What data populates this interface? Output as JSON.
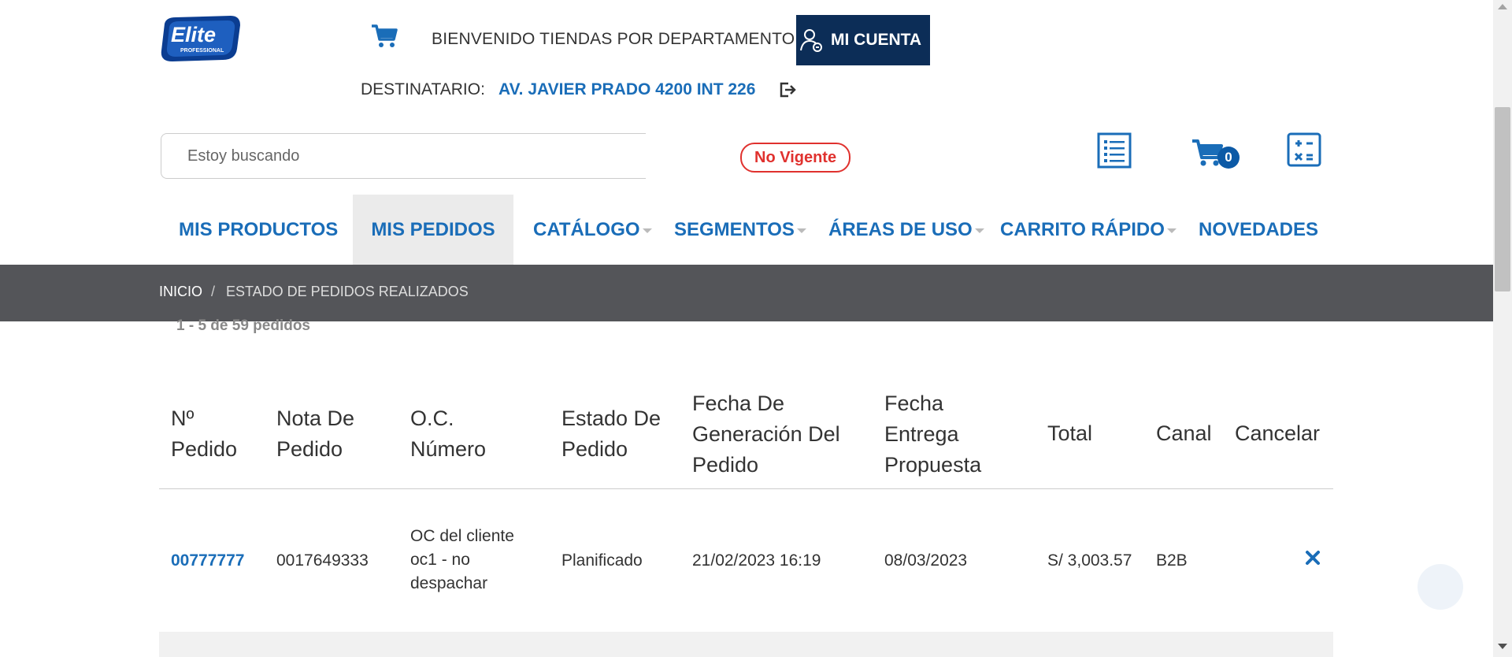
{
  "header": {
    "logo_text": "Elite",
    "logo_subtext": "PROFESSIONAL",
    "welcome_text": "BIENVENIDO TIENDAS POR DEPARTAMENTO",
    "account_label": "MI CUENTA",
    "destinatario_label": "DESTINATARIO:",
    "destinatario_value": "AV. JAVIER PRADO 4200 INT 226"
  },
  "search": {
    "placeholder": "Estoy buscando"
  },
  "status_badge": "No Vigente",
  "cart": {
    "count": "0"
  },
  "nav": {
    "items": [
      {
        "label": "MIS PRODUCTOS"
      },
      {
        "label": "MIS PEDIDOS"
      },
      {
        "label": "CATÁLOGO"
      },
      {
        "label": "SEGMENTOS"
      },
      {
        "label": "ÁREAS DE USO"
      },
      {
        "label": "CARRITO RÁPIDO"
      },
      {
        "label": "NOVEDADES"
      }
    ]
  },
  "breadcrumb": {
    "home": "INICIO",
    "separator": "/",
    "current": "ESTADO DE PEDIDOS REALIZADOS"
  },
  "results_count": "1 - 5 de 59 pedidos",
  "table": {
    "headers": {
      "pedido": "Nº Pedido",
      "nota": "Nota De Pedido",
      "oc": "O.C. Número",
      "estado": "Estado De Pedido",
      "fecha_gen": "Fecha De Generación Del Pedido",
      "fecha_ent": "Fecha Entrega Propuesta",
      "total": "Total",
      "canal": "Canal",
      "cancelar": "Cancelar"
    },
    "rows": [
      {
        "pedido": "00777777",
        "nota": "0017649333",
        "oc": "OC del cliente oc1 - no despachar",
        "estado": "Planificado",
        "fecha_gen": "21/02/2023 16:19",
        "fecha_ent": "08/03/2023",
        "total": "S/ 3,003.57",
        "canal": "B2B"
      }
    ]
  },
  "colors": {
    "brand_blue": "#1a6db8",
    "dark_navy": "#0c2d57",
    "status_red": "#e0312e",
    "breadcrumb_bg": "#545559"
  }
}
